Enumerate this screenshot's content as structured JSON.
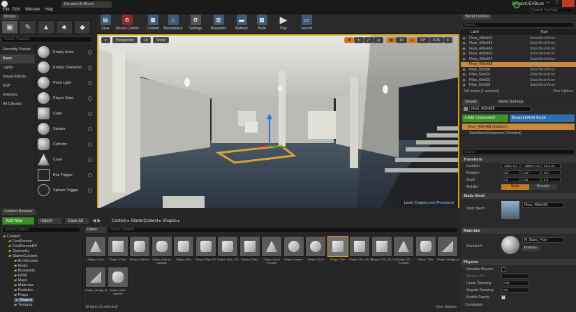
{
  "window": {
    "tab_title": "BlenderUE4Book",
    "app_title": "BlenderUE4Book",
    "search_help_placeholder": "Search For Help",
    "menu": [
      "File",
      "Edit",
      "Window",
      "Help"
    ]
  },
  "modes": {
    "tab_label": "Modes",
    "search_placeholder": "Search Classes",
    "categories": [
      "Recently Placed",
      "Basic",
      "Lights",
      "Visual Effects",
      "BSP",
      "Volumes",
      "All Classes"
    ],
    "selected_category": "Basic",
    "items": [
      "Empty Actor",
      "Empty Character",
      "Point Light",
      "Player Start",
      "Cube",
      "Sphere",
      "Cylinder",
      "Cone",
      "Box Trigger",
      "Sphere Trigger"
    ]
  },
  "toolbar": {
    "buttons": [
      "Save",
      "Source Control",
      "Content",
      "Marketplace",
      "Settings",
      "Blueprints",
      "Matinee",
      "Build",
      "Play",
      "Launch"
    ]
  },
  "viewport": {
    "perspective": "Perspective",
    "lit": "Lit",
    "show": "Show",
    "grid_value": "10",
    "angle_value": "10°",
    "scale_value": "0.25",
    "camera_speed": "4",
    "level_prefix": "Level:",
    "level_name": "ChapterLevel (Persistent)"
  },
  "outliner": {
    "tab_label": "World Outliner",
    "search_placeholder": "Search...",
    "col_label": "Label",
    "col_type": "Type",
    "rows": [
      {
        "label": "Floor_400x463",
        "type": "StaticMeshActor",
        "selected": false
      },
      {
        "label": "Floor_400x464",
        "type": "StaticMeshActor",
        "selected": false
      },
      {
        "label": "Floor_400x465",
        "type": "StaticMeshActor",
        "selected": false
      },
      {
        "label": "Floor_400x466",
        "type": "StaticMeshActor",
        "selected": false
      },
      {
        "label": "Floor_400x467",
        "type": "StaticMeshActor",
        "selected": false
      },
      {
        "label": "Floor_400x468",
        "type": "StaticMeshActor",
        "selected": true
      },
      {
        "label": "Pillar_50x500",
        "type": "StaticMeshActor",
        "selected": false
      },
      {
        "label": "Pillar_50x501",
        "type": "StaticMeshActor",
        "selected": false
      },
      {
        "label": "Pillar_50x502",
        "type": "StaticMeshActor",
        "selected": false
      },
      {
        "label": "Pillar_50x503",
        "type": "StaticMeshActor",
        "selected": false
      }
    ],
    "footer": "598 actors (1 selected)",
    "view_options": "View Options"
  },
  "details": {
    "tab_label": "Details",
    "tab2_label": "World Settings",
    "actor_name": "Floor_400x468",
    "add_component": "+ Add Component",
    "blueprint_script": "Blueprint/Add Script",
    "instance_label": "Floor_400x468 (Instance)",
    "component_label": "StaticMeshComponent (Inherited)",
    "search_placeholder": "Search",
    "transform_title": "Transform",
    "location_label": "Location",
    "rotation_label": "Rotation",
    "scale_label": "Scale",
    "mobility_label": "Mobility",
    "location": [
      "-430.0 cm",
      "-2380.0 cm",
      "15.0 cm"
    ],
    "rotation": [
      "0.0 °",
      "0.0 °",
      "0.0 °"
    ],
    "scale": [
      "0.9",
      "0.9",
      "0.9"
    ],
    "mobility_static": "Static",
    "mobility_movable": "Movable",
    "static_mesh_title": "Static Mesh",
    "static_mesh_label": "Static Mesh",
    "static_mesh_value": "Floor_400x400",
    "materials_title": "Materials",
    "element_label": "Element 0",
    "material_value": "M_Basic_Floor",
    "textures_label": "Textures",
    "physics_title": "Physics",
    "simulate_physics": "Simulate Physics",
    "mass_in_kg": "Mass in KG",
    "linear_damping": "Linear Damping",
    "linear_damping_value": "0.01",
    "angular_damping": "Angular Damping",
    "angular_damping_value": "0.0",
    "enable_gravity": "Enable Gravity",
    "constraints": "Constraints"
  },
  "content_browser": {
    "tab_label": "Content Browser",
    "add_new": "Add New",
    "import": "Import",
    "save_all": "Save All",
    "path": [
      "Content",
      "StarterContent",
      "Shapes"
    ],
    "search_folders_placeholder": "Search Folders",
    "filters": "Filters",
    "search_shapes_placeholder": "Search Shapes",
    "tree": [
      {
        "label": "Content",
        "depth": 0
      },
      {
        "label": "FirstPerson",
        "depth": 1
      },
      {
        "label": "FirstPersonBP",
        "depth": 1
      },
      {
        "label": "Geometry",
        "depth": 1
      },
      {
        "label": "StarterContent",
        "depth": 1
      },
      {
        "label": "Architecture",
        "depth": 2
      },
      {
        "label": "Audio",
        "depth": 2
      },
      {
        "label": "Blueprints",
        "depth": 2
      },
      {
        "label": "HDRI",
        "depth": 2
      },
      {
        "label": "Maps",
        "depth": 2
      },
      {
        "label": "Materials",
        "depth": 2
      },
      {
        "label": "Particles",
        "depth": 2
      },
      {
        "label": "Props",
        "depth": 2
      },
      {
        "label": "Shapes",
        "depth": 2,
        "selected": true
      },
      {
        "label": "Textures",
        "depth": 2
      }
    ],
    "assets": [
      "Shape_Cone",
      "Shape_Cube",
      "Shape_Cylinder",
      "Shape_Narrow Capsule",
      "Shape_Pipe",
      "Shape_Pipe_90",
      "Shape_Pipe_180",
      "Shape_Plane",
      "Shape_Quad Pyramid",
      "Shape_Sphere",
      "Shape_Torus",
      "Shape_Trim",
      "Shape_Trim_90_In",
      "Shape_Trim_90_Out",
      "Shape_Tri Pyramid",
      "Shape_Tube",
      "Shape_Wedge_A",
      "Shape_Wedge_B",
      "Shape_Wide Capsule"
    ],
    "selected_asset": "Shape_Trim",
    "footer": "19 items (1 selected)",
    "view_options": "View Options"
  }
}
